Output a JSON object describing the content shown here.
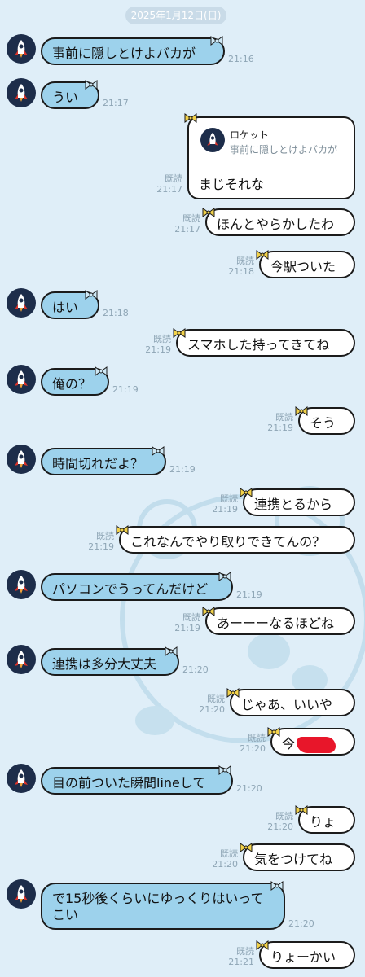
{
  "header": {
    "date": "2025年1月12日(日)"
  },
  "read_label": "既読",
  "reply": {
    "quoted_name": "ロケット",
    "quoted_text": "事前に隠しとけよバカが",
    "text": "まじそれな",
    "time": "21:17"
  },
  "messages": [
    {
      "side": "in",
      "text": "事前に隠しとけよバカが",
      "time": "21:16"
    },
    {
      "side": "in",
      "text": "うい",
      "time": "21:17"
    },
    {
      "side": "out",
      "text": "ほんとやらかしたわ",
      "time": "21:17"
    },
    {
      "side": "out",
      "text": "今駅ついた",
      "time": "21:18"
    },
    {
      "side": "in",
      "text": "はい",
      "time": "21:18"
    },
    {
      "side": "out",
      "text": "スマホした持ってきてね",
      "time": "21:19"
    },
    {
      "side": "in",
      "text": "俺の？",
      "time": "21:19"
    },
    {
      "side": "out",
      "text": "そう",
      "time": "21:19"
    },
    {
      "side": "in",
      "text": "時間切れだよ？",
      "time": "21:19"
    },
    {
      "side": "out",
      "text": "連携とるから",
      "time": "21:19"
    },
    {
      "side": "out",
      "text": "これなんでやり取りできてんの？",
      "time": "21:19"
    },
    {
      "side": "in",
      "text": "パソコンでうってんだけど",
      "time": "21:19"
    },
    {
      "side": "out",
      "text": "あーーーなるほどね",
      "time": "21:19"
    },
    {
      "side": "in",
      "text": "連携は多分大丈夫",
      "time": "21:20"
    },
    {
      "side": "out",
      "text": "じゃあ、いいや",
      "time": "21:20"
    },
    {
      "side": "out",
      "text": "今",
      "time": "21:20"
    },
    {
      "side": "in",
      "text": "目の前ついた瞬間lineして",
      "time": "21:20"
    },
    {
      "side": "out",
      "text": "りょ",
      "time": "21:20"
    },
    {
      "side": "out",
      "text": "気をつけてね",
      "time": "21:20"
    },
    {
      "side": "in",
      "text": "で15秒後くらいにゆっくりはいってこい",
      "time": "21:20"
    },
    {
      "side": "out",
      "text": "りょーかい",
      "time": "21:21"
    }
  ],
  "colors": {
    "background": "#dfeef8",
    "incoming_bubble": "#9dd2ec",
    "outgoing_bubble": "#ffffff",
    "meta_text": "#8ea5b5"
  },
  "icons": {
    "avatar": "rocket-avatar-icon",
    "bubble_decoration": "ribbon-bow-icon"
  }
}
